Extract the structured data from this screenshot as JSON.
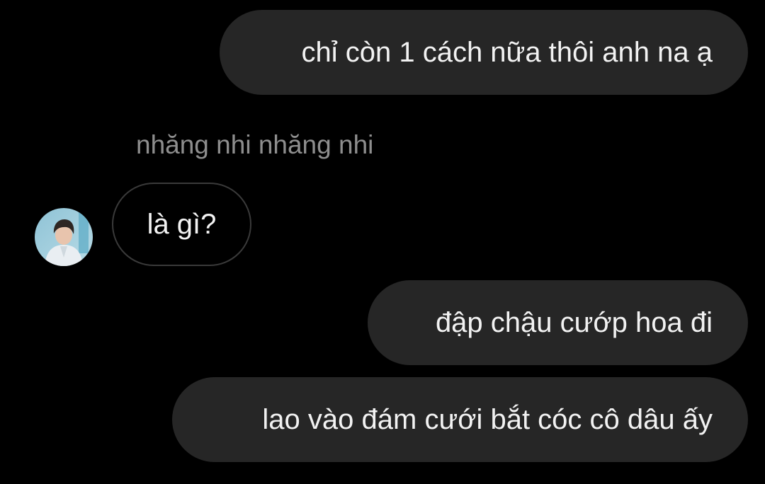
{
  "thread": {
    "sender_name": "nhăng nhi nhăng nhi",
    "messages": [
      {
        "direction": "outgoing",
        "text": "chỉ còn 1 cách nữa thôi anh na ạ"
      },
      {
        "direction": "incoming",
        "text": "là gì?"
      },
      {
        "direction": "outgoing",
        "text": "đập chậu cướp hoa đi"
      },
      {
        "direction": "outgoing",
        "text": "lao vào đám cưới bắt cóc cô dâu ấy"
      }
    ]
  },
  "colors": {
    "background": "#000000",
    "outgoing_bubble": "#262626",
    "incoming_border": "#3a3a3a",
    "message_text": "#f2f2f2",
    "sender_name_text": "#8e8e8e"
  },
  "icons": {
    "avatar": "sender-avatar-photo"
  }
}
